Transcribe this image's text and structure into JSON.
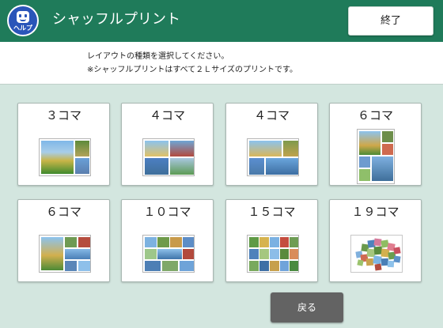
{
  "header": {
    "help_label": "ヘルプ",
    "title": "シャッフルプリント",
    "end_label": "終了",
    "bg_color": "#1f7b5a"
  },
  "instructions": {
    "line1": "レイアウトの種類を選択してください。",
    "line2": "※シャッフルプリントはすべて２Ｌサイズのプリントです。"
  },
  "layouts": [
    {
      "label": "３コマ"
    },
    {
      "label": "４コマ"
    },
    {
      "label": "４コマ"
    },
    {
      "label": "６コマ"
    },
    {
      "label": "６コマ"
    },
    {
      "label": "１０コマ"
    },
    {
      "label": "１５コマ"
    },
    {
      "label": "１９コマ"
    }
  ],
  "back_label": "戻る"
}
